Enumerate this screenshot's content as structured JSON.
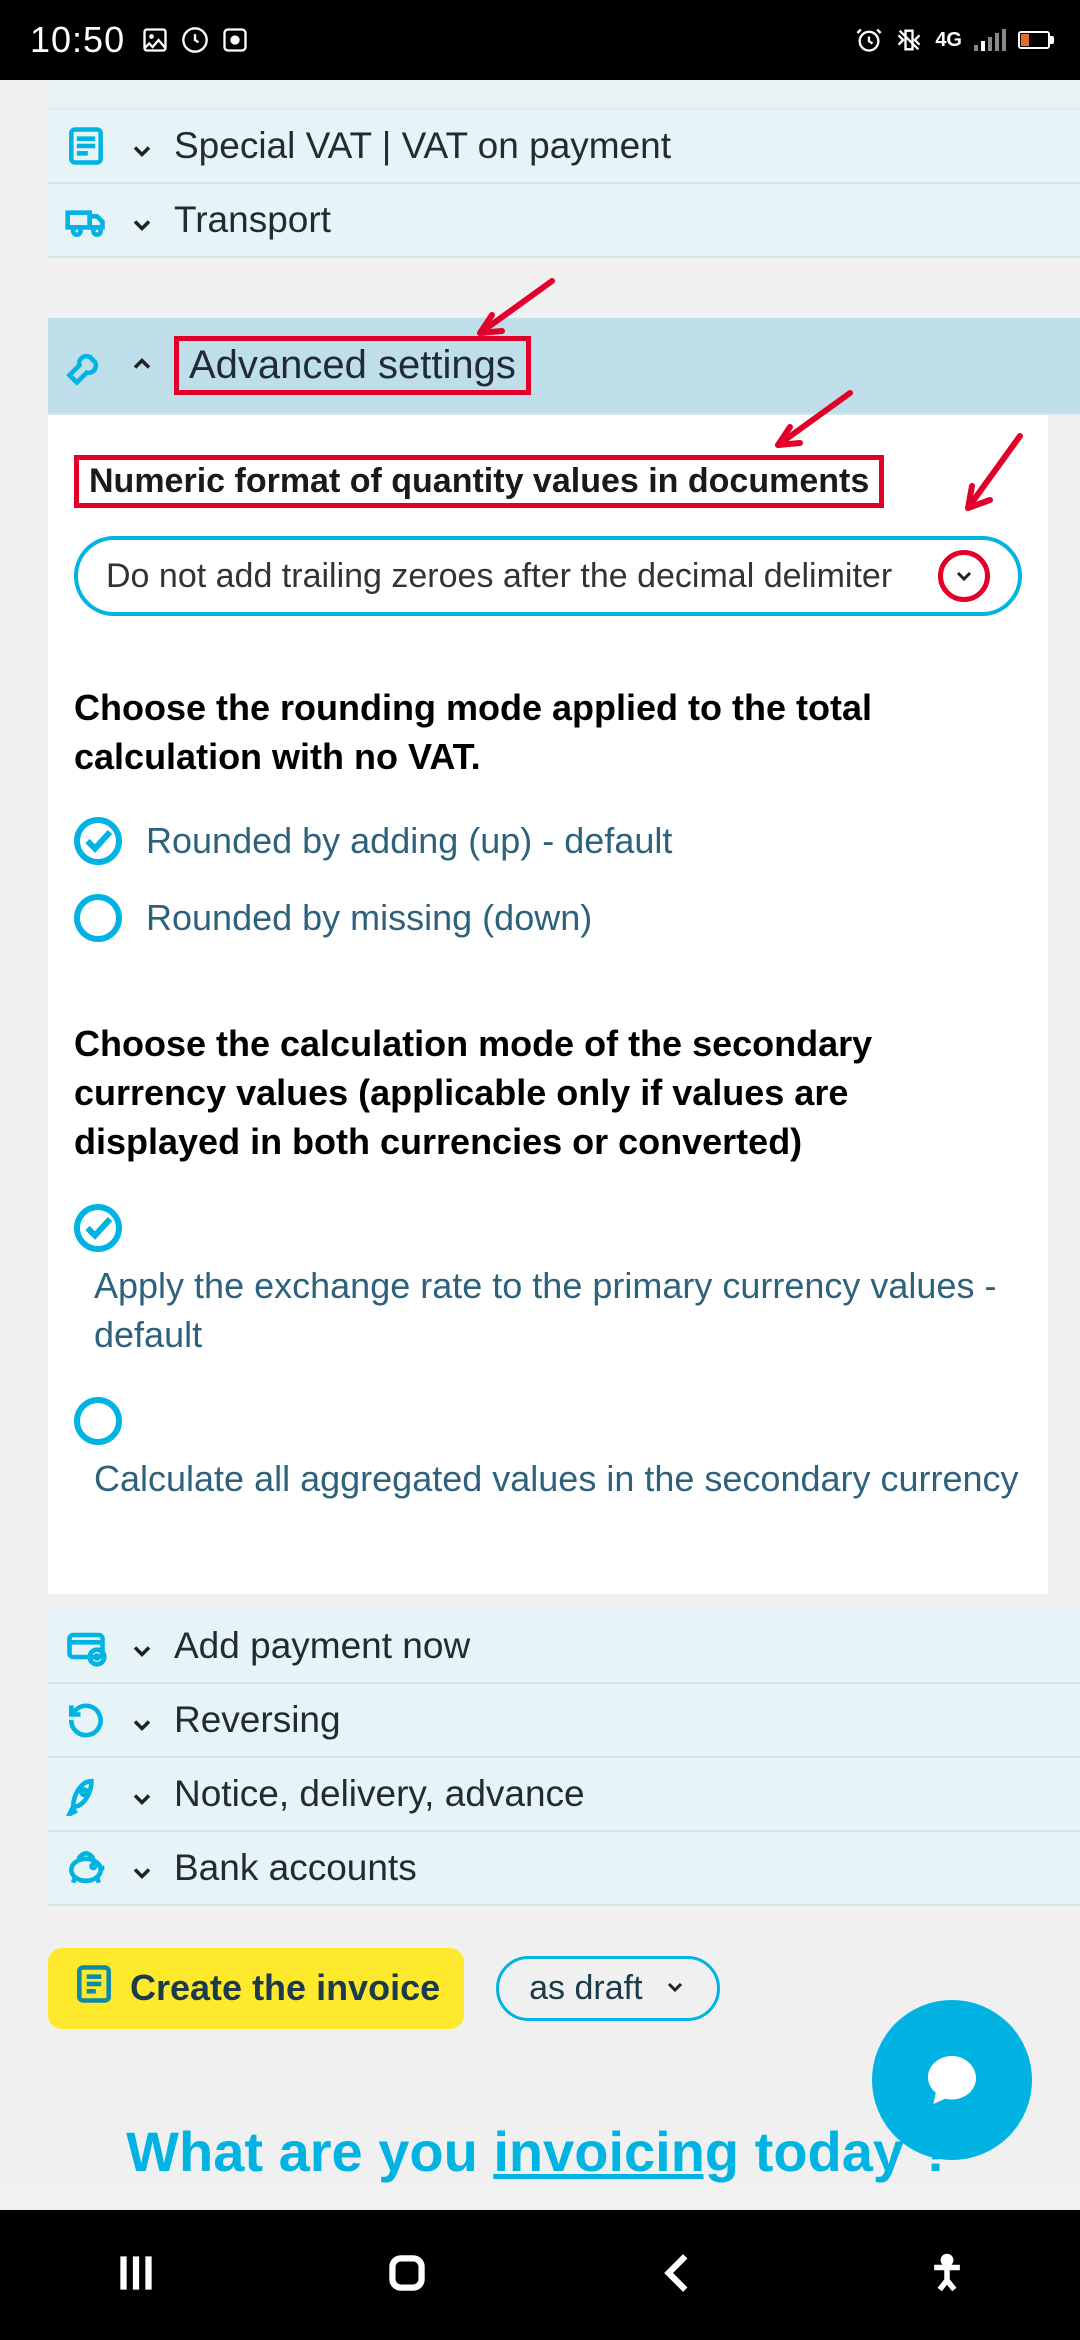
{
  "status": {
    "time": "10:50",
    "network_label": "4G"
  },
  "accordions_top": [
    {
      "label": "Special VAT | VAT on payment"
    },
    {
      "label": "Transport"
    }
  ],
  "advanced": {
    "title": "Advanced settings",
    "numeric_format_label": "Numeric format of quantity values in documents",
    "numeric_format_value": "Do not add trailing zeroes after the decimal delimiter",
    "rounding_heading": "Choose the rounding mode applied to the total calculation with no VAT.",
    "rounding_options": [
      {
        "label": "Rounded by adding (up) - default",
        "checked": true
      },
      {
        "label": "Rounded by missing (down)",
        "checked": false
      }
    ],
    "currency_heading": "Choose the calculation mode of the secondary currency values (applicable only if values are displayed in both currencies or converted)",
    "currency_options": [
      {
        "label": "Apply the exchange rate to the primary currency values - default",
        "checked": true
      },
      {
        "label": "Calculate all aggregated values in the secondary currency",
        "checked": false
      }
    ]
  },
  "accordions_bottom": [
    {
      "label": "Add payment now"
    },
    {
      "label": "Reversing"
    },
    {
      "label": "Notice, delivery, advance"
    },
    {
      "label": "Bank accounts"
    }
  ],
  "actions": {
    "create_label": "Create the invoice",
    "draft_label": "as draft"
  },
  "tagline": {
    "pre": "What are you ",
    "underlined": "invoicing",
    "post": " today ?"
  }
}
